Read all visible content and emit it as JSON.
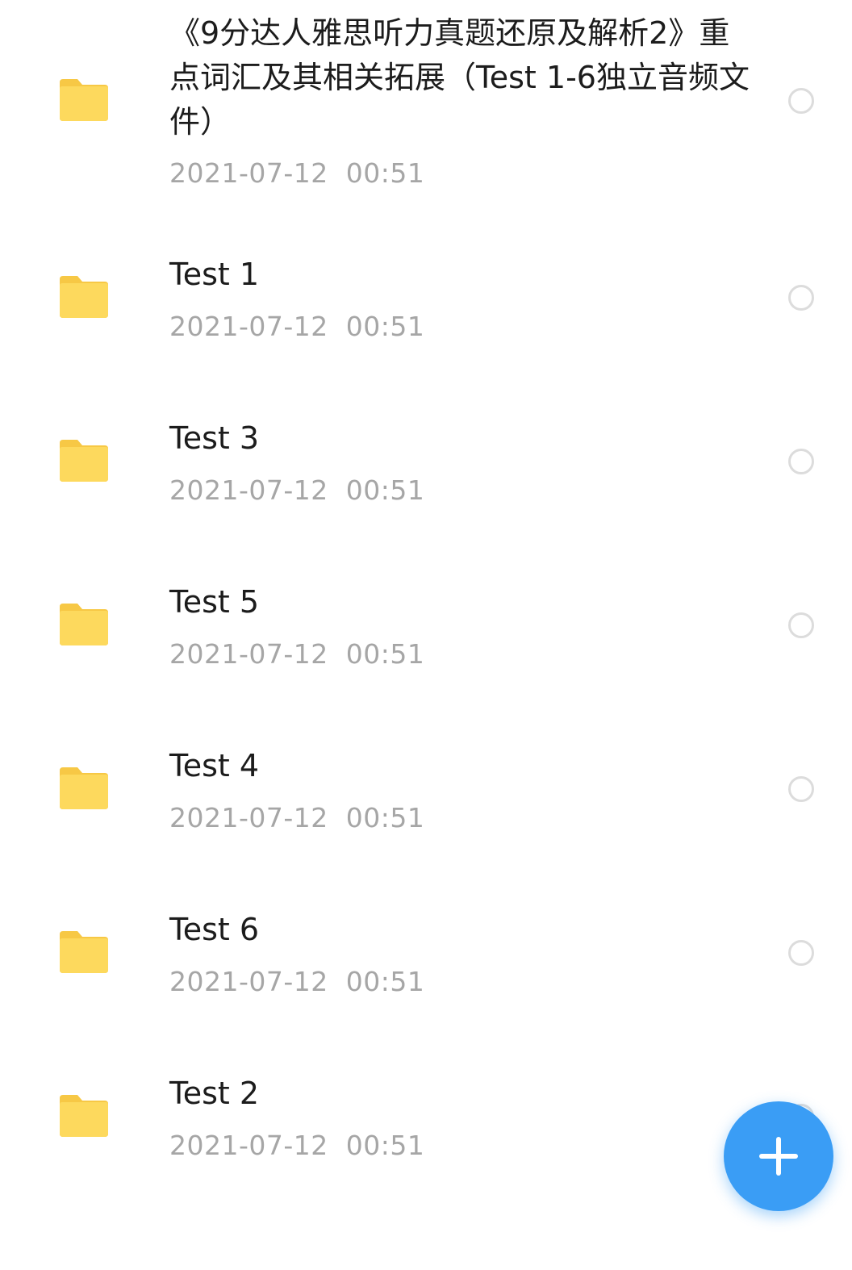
{
  "colors": {
    "folder": "#FDD95D",
    "folder_tab": "#F7C845",
    "title_text": "#1C1C1C",
    "meta_text": "#A6A6A6",
    "radio_border": "#DCDCDC",
    "fab_background": "#3A9DF5"
  },
  "files": [
    {
      "icon": "folder-icon",
      "name": "《9分达人雅思听力真题还原及解析2》重点词汇及其相关拓展（Test 1-6独立音频文件）",
      "modified": "2021-07-12  00:51",
      "selected": false
    },
    {
      "icon": "folder-icon",
      "name": "Test 1",
      "modified": "2021-07-12  00:51",
      "selected": false
    },
    {
      "icon": "folder-icon",
      "name": "Test 3",
      "modified": "2021-07-12  00:51",
      "selected": false
    },
    {
      "icon": "folder-icon",
      "name": "Test 5",
      "modified": "2021-07-12  00:51",
      "selected": false
    },
    {
      "icon": "folder-icon",
      "name": "Test 4",
      "modified": "2021-07-12  00:51",
      "selected": false
    },
    {
      "icon": "folder-icon",
      "name": "Test 6",
      "modified": "2021-07-12  00:51",
      "selected": false
    },
    {
      "icon": "folder-icon",
      "name": "Test 2",
      "modified": "2021-07-12  00:51",
      "selected": false
    }
  ],
  "fab": {
    "icon": "plus-icon"
  }
}
